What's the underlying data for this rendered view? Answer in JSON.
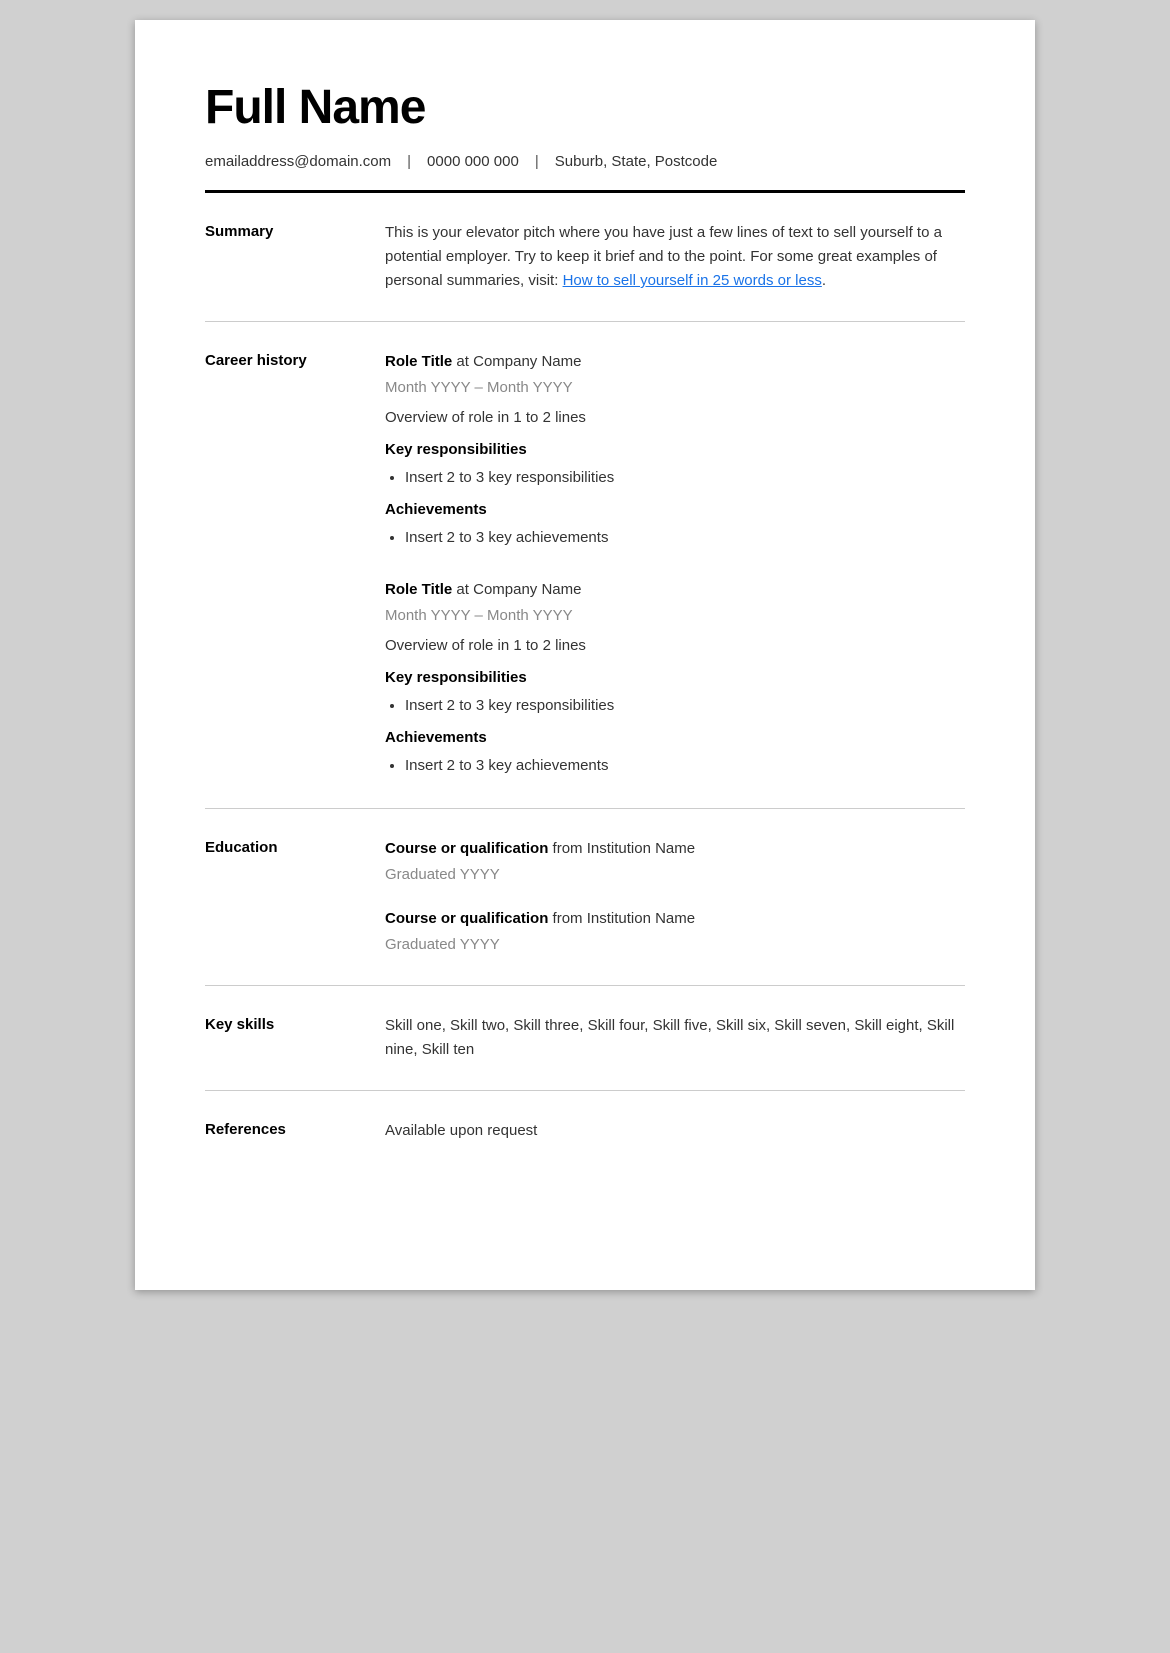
{
  "header": {
    "name": "Full Name",
    "email": "emailaddress@domain.com",
    "phone": "0000 000 000",
    "location": "Suburb, State, Postcode"
  },
  "summary": {
    "label": "Summary",
    "text_before_link": "This is your elevator pitch where you have just a few lines of text to sell yourself to a potential employer. Try to keep it brief and to the point. For some great examples of personal summaries, visit: ",
    "link_text": "How to sell yourself in 25 words or less",
    "link_href": "#",
    "text_after_link": "."
  },
  "career_history": {
    "label": "Career history",
    "jobs": [
      {
        "role_title": "Role Title",
        "company": "Company Name",
        "dates": "Month YYYY – Month YYYY",
        "overview": "Overview of role in 1 to 2 lines",
        "responsibilities_heading": "Key responsibilities",
        "responsibilities": [
          "Insert 2 to 3 key responsibilities"
        ],
        "achievements_heading": "Achievements",
        "achievements": [
          "Insert 2 to 3 key achievements"
        ]
      },
      {
        "role_title": "Role Title",
        "company": "Company Name",
        "dates": "Month YYYY – Month YYYY",
        "overview": "Overview of role in 1 to 2 lines",
        "responsibilities_heading": "Key responsibilities",
        "responsibilities": [
          "Insert 2 to 3 key responsibilities"
        ],
        "achievements_heading": "Achievements",
        "achievements": [
          "Insert 2 to 3 key achievements"
        ]
      }
    ]
  },
  "education": {
    "label": "Education",
    "entries": [
      {
        "course": "Course or qualification",
        "institution": "Institution Name",
        "graduated": "Graduated YYYY"
      },
      {
        "course": "Course or qualification",
        "institution": "Institution Name",
        "graduated": "Graduated YYYY"
      }
    ]
  },
  "key_skills": {
    "label": "Key skills",
    "skills_text": "Skill one, Skill two, Skill three, Skill four, Skill five, Skill six, Skill seven, Skill eight, Skill nine, Skill ten"
  },
  "references": {
    "label": "References",
    "text": "Available upon request"
  }
}
